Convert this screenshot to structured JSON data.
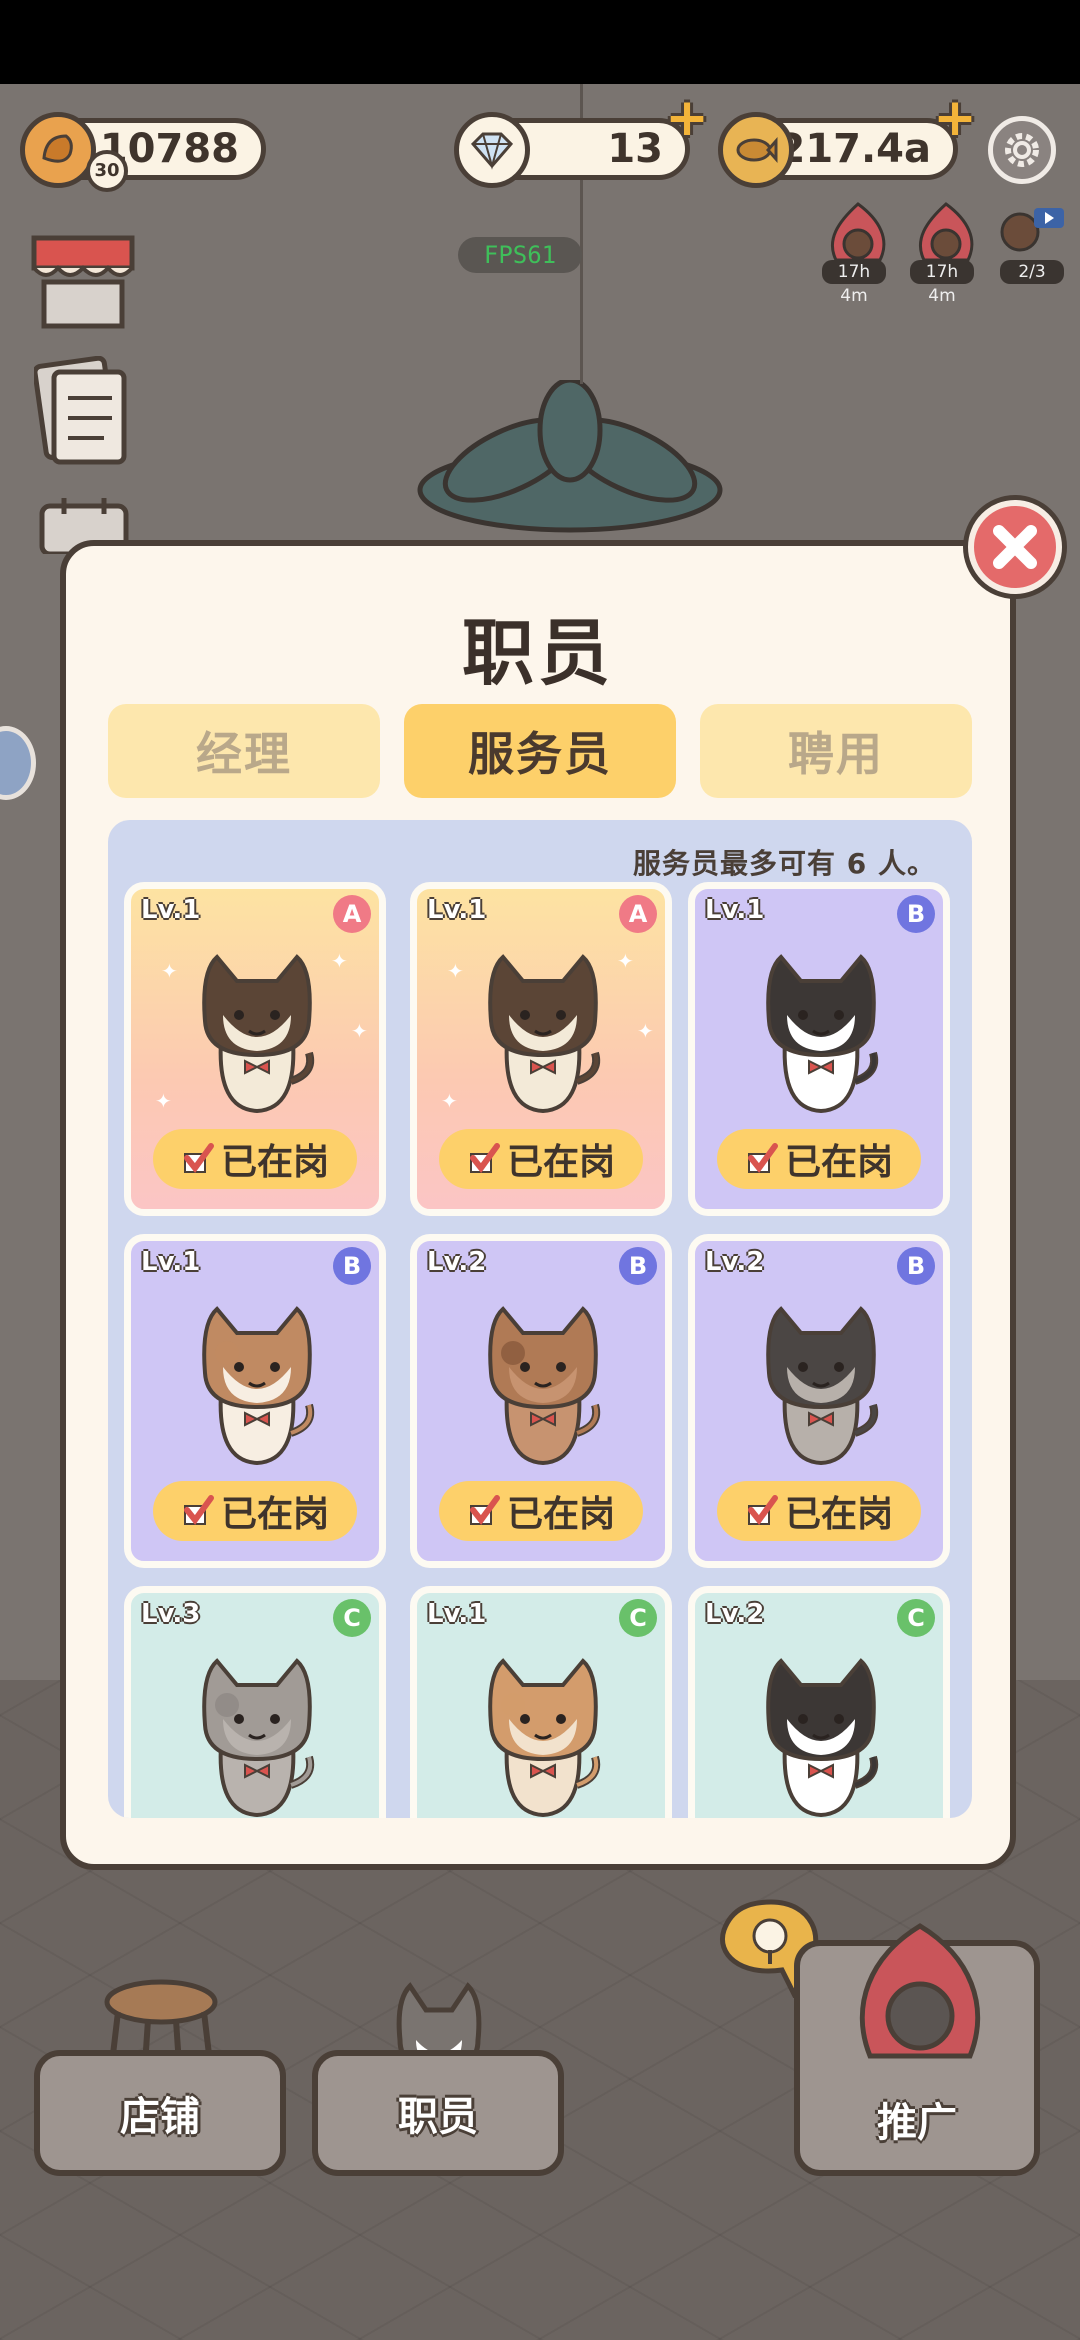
{
  "hud": {
    "level": "30",
    "coins": "10788",
    "diamonds": "13",
    "fish": "217.4a",
    "fps": "FPS61",
    "timer_1": "17h 4m",
    "timer_2": "17h 4m",
    "video_count": "2/3"
  },
  "modal": {
    "title": "职员",
    "tabs": [
      {
        "label": "经理",
        "active": false
      },
      {
        "label": "服务员",
        "active": true
      },
      {
        "label": "聘用",
        "active": false
      }
    ],
    "note": "服务员最多可有 6 人。",
    "cards": [
      {
        "level": "Lv.1",
        "rank": "A",
        "status": "已在岗",
        "cat": "siamese"
      },
      {
        "level": "Lv.1",
        "rank": "A",
        "status": "已在岗",
        "cat": "siamese"
      },
      {
        "level": "Lv.1",
        "rank": "B",
        "status": "已在岗",
        "cat": "tuxedo"
      },
      {
        "level": "Lv.1",
        "rank": "B",
        "status": "已在岗",
        "cat": "calico"
      },
      {
        "level": "Lv.2",
        "rank": "B",
        "status": "已在岗",
        "cat": "tabby"
      },
      {
        "level": "Lv.2",
        "rank": "B",
        "status": "已在岗",
        "cat": "grey"
      },
      {
        "level": "Lv.3",
        "rank": "C",
        "status": "",
        "cat": "fluffy-grey"
      },
      {
        "level": "Lv.1",
        "rank": "C",
        "status": "",
        "cat": "fluffy-calico"
      },
      {
        "level": "Lv.2",
        "rank": "C",
        "status": "",
        "cat": "black-white"
      }
    ]
  },
  "bottom_nav": {
    "shop": "店铺",
    "staff": "职员",
    "promote": "推广"
  },
  "colors": {
    "outline": "#4a3f37",
    "tab_active": "#fdd06a",
    "tab_inactive": "#fde7ad",
    "close": "#e46a6a"
  }
}
